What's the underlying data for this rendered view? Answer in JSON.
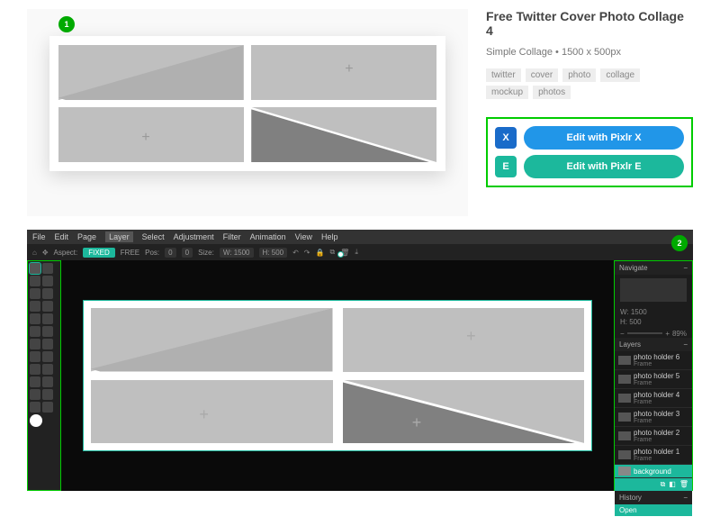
{
  "product": {
    "title": "Free Twitter Cover Photo Collage 4",
    "subtitle": "Simple Collage • 1500 x 500px",
    "tags": [
      "twitter",
      "cover",
      "photo",
      "collage",
      "mockup",
      "photos"
    ],
    "badge": "1"
  },
  "buttons": {
    "pixlr_x": {
      "icon": "X",
      "label": "Edit with Pixlr X"
    },
    "pixlr_e": {
      "icon": "E",
      "label": "Edit with Pixlr E"
    }
  },
  "editor": {
    "badge": "2",
    "menu": [
      "File",
      "Edit",
      "Page",
      "Layer",
      "Select",
      "Adjustment",
      "Filter",
      "Animation",
      "View",
      "Help"
    ],
    "active_menu": "Layer",
    "toolbar": {
      "aspect_label": "Aspect:",
      "fixed": "FIXED",
      "free": "FREE",
      "pos_label": "Pos:",
      "pos_x": "0",
      "pos_y": "0",
      "size_label": "Size:",
      "size_w": "W: 1500",
      "size_h": "H: 500"
    },
    "navigate": {
      "title": "Navigate",
      "w": "W: 1500",
      "h": "H: 500",
      "zoom": "89%"
    },
    "layers": {
      "title": "Layers",
      "items": [
        {
          "name": "photo holder 6",
          "type": "Frame"
        },
        {
          "name": "photo holder 5",
          "type": "Frame"
        },
        {
          "name": "photo holder 4",
          "type": "Frame"
        },
        {
          "name": "photo holder 3",
          "type": "Frame"
        },
        {
          "name": "photo holder 2",
          "type": "Frame"
        },
        {
          "name": "photo holder 1",
          "type": "Frame"
        },
        {
          "name": "background",
          "type": ""
        }
      ]
    },
    "history": {
      "title": "History",
      "current": "Open"
    }
  }
}
